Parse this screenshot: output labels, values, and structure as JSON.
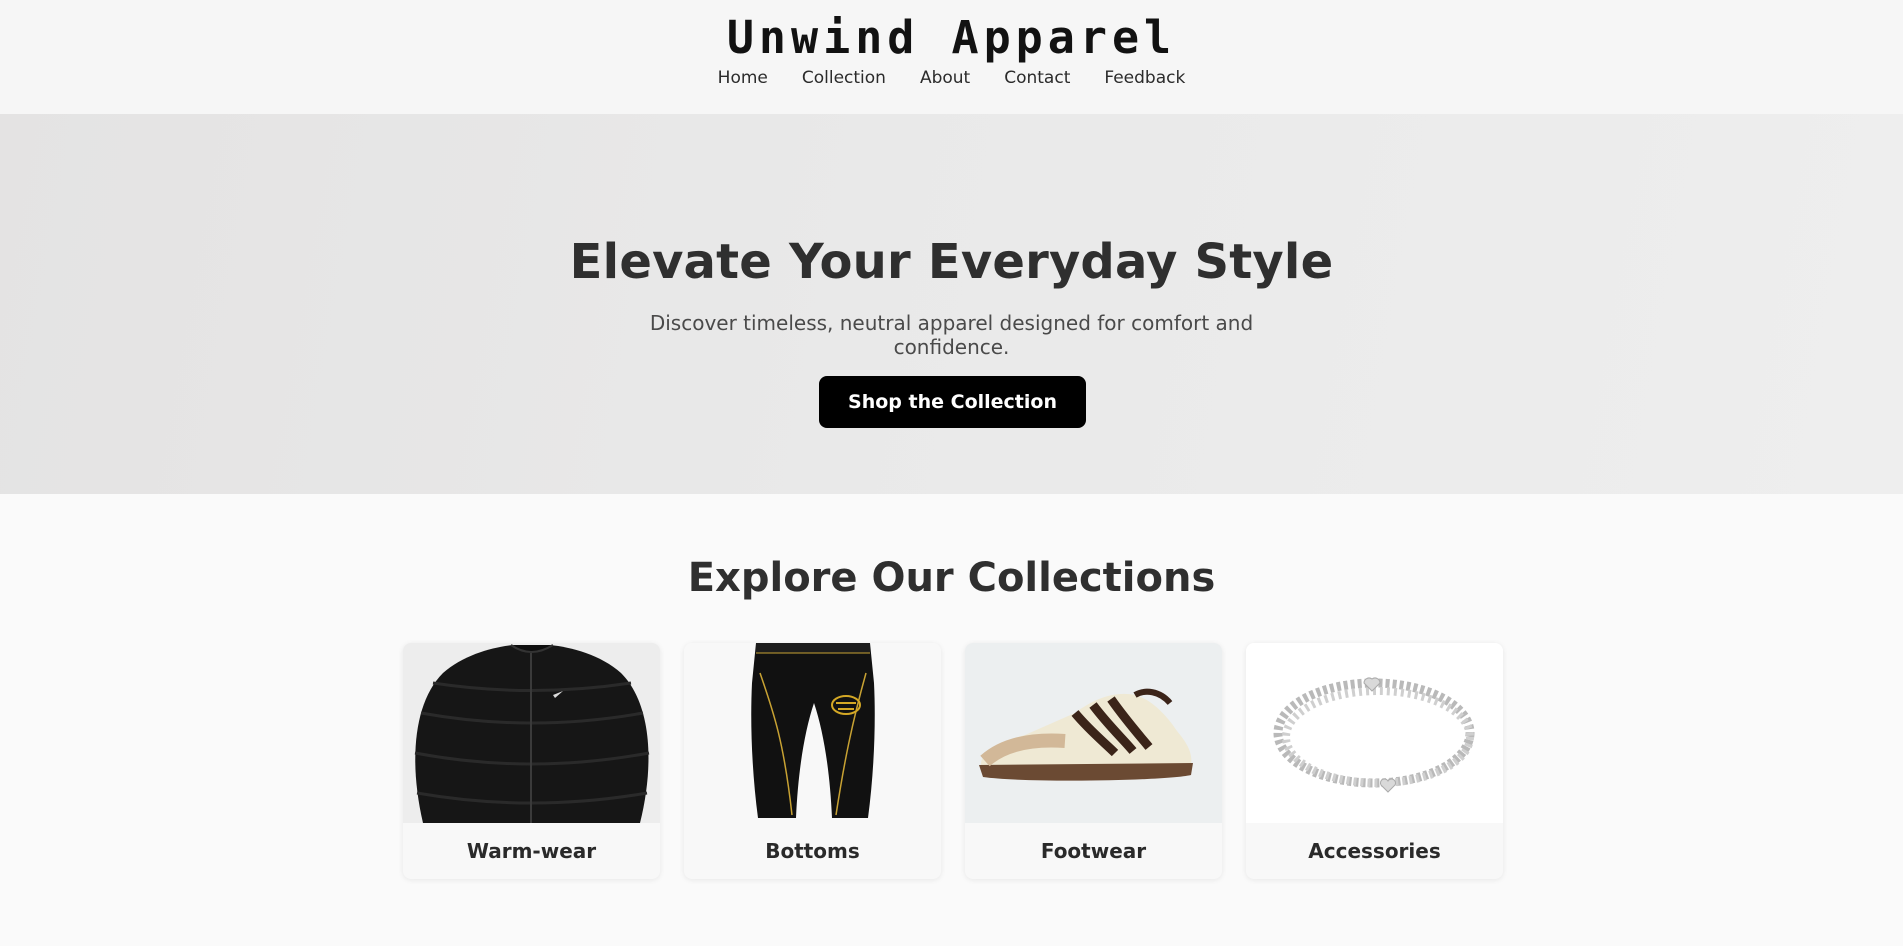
{
  "brand": {
    "name": "Unwind Apparel"
  },
  "nav": [
    {
      "label": "Home"
    },
    {
      "label": "Collection"
    },
    {
      "label": "About"
    },
    {
      "label": "Contact"
    },
    {
      "label": "Feedback"
    }
  ],
  "hero": {
    "title": "Elevate Your Everyday Style",
    "subtitle": "Discover timeless, neutral apparel designed for comfort and confidence.",
    "cta": "Shop the Collection"
  },
  "collections": {
    "title": "Explore Our Collections",
    "items": [
      {
        "label": "Warm-wear",
        "image": "black-puffer-jacket"
      },
      {
        "label": "Bottoms",
        "image": "black-joggers"
      },
      {
        "label": "Footwear",
        "image": "cream-brown-sneaker"
      },
      {
        "label": "Accessories",
        "image": "silver-bead-bracelet"
      }
    ]
  },
  "colors": {
    "header_bg": "#f6f6f6",
    "hero_bg": "#e9e9e9",
    "button_bg": "#000000",
    "text": "#2e2e2e"
  }
}
